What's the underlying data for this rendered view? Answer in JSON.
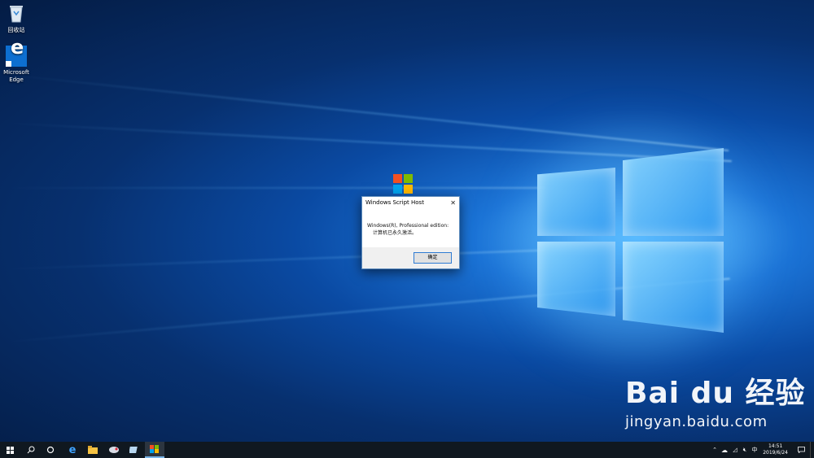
{
  "desktop": {
    "icons": [
      {
        "name": "recycle-bin",
        "label": "回收站"
      },
      {
        "name": "microsoft-edge",
        "label_line1": "Microsoft",
        "label_line2": "Edge"
      }
    ]
  },
  "dialog": {
    "title": "Windows Script Host",
    "close_glyph": "✕",
    "message_line1": "Windows(R), Professional edition:",
    "message_line2": "计算机已永久激活。",
    "ok_label": "确定"
  },
  "watermark": {
    "brand": "Bai du 经验",
    "url": "jingyan.baidu.com"
  },
  "taskbar": {
    "apps": [
      "start-icon",
      "search-icon",
      "task-view-icon",
      "edge-icon",
      "file-explorer-icon",
      "app-icon",
      "app-icon",
      "script-host-icon"
    ],
    "tray": {
      "ime": "中",
      "time": "14:51",
      "date": "2019/6/24"
    }
  },
  "colors": {
    "accent": "#0a4aa3",
    "taskbar": "#101820"
  }
}
